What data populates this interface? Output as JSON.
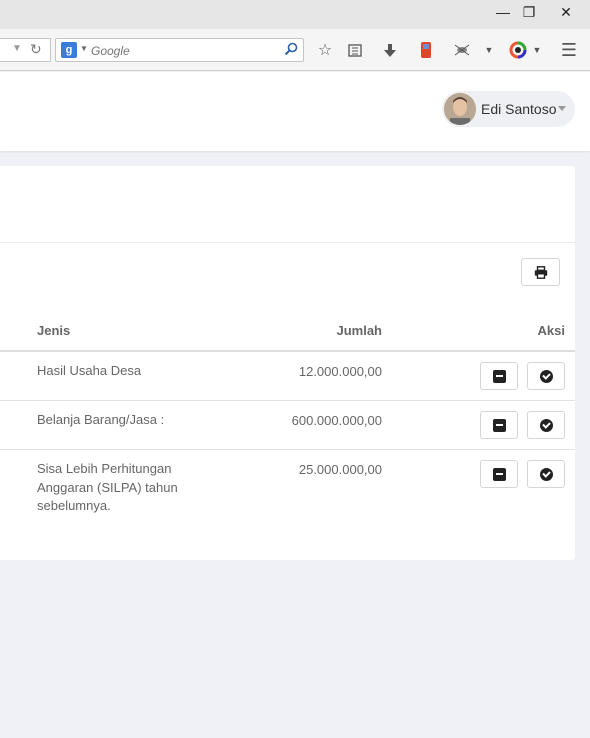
{
  "window": {
    "minimize_icon": "minimize-icon",
    "restore_icon": "restore-icon",
    "close_icon": "close-icon"
  },
  "browser": {
    "search_engine": "Google",
    "search_placeholder": "Google",
    "toolbar_icons": [
      "star-icon",
      "reading-list-icon",
      "download-icon",
      "extension-icon",
      "bug-extension-icon",
      "color-extension-icon",
      "menu-icon"
    ]
  },
  "header": {
    "user_name": "Edi Santoso"
  },
  "table": {
    "columns": [
      "Jenis",
      "Jumlah",
      "Aksi"
    ],
    "rows": [
      {
        "jenis": "Hasil Usaha Desa",
        "jumlah": "12.000.000,00"
      },
      {
        "jenis": "Belanja Barang/Jasa :",
        "jumlah": "600.000.000,00"
      },
      {
        "jenis": "Sisa Lebih Perhitungan Anggaran (SILPA) tahun sebelumnya.",
        "jumlah": "25.000.000,00"
      }
    ]
  }
}
